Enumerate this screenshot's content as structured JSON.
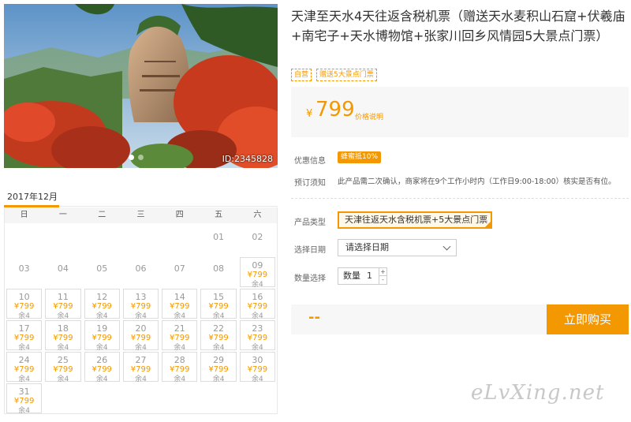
{
  "product": {
    "title": "天津至天水4天往返含税机票（赠送天水麦积山石窟+伏羲庙+南宅子+天水博物馆+张家川回乡风情园5大景点门票）",
    "tags": [
      "自营"
    ],
    "tags2": [
      "赠送5大景点门票"
    ]
  },
  "gallery": {
    "photo_id": "ID:2345828"
  },
  "price": {
    "currency": "¥",
    "value": "799",
    "note": "价格说明"
  },
  "offers": {
    "discount_label": "优惠信息",
    "discount_badge": "蜂蜜抵10%",
    "notice_label": "预订须知",
    "notice_text": "此产品需二次确认，商家将在9个工作小时内（工作日9:00-18:00）核实是否有位。"
  },
  "options": {
    "type_label": "产品类型",
    "type_value": "天津往返天水含税机票+5大景点门票",
    "date_label": "选择日期",
    "date_placeholder": "请选择日期",
    "qty_label": "数量选择",
    "qty_prefix": "数量",
    "qty_value": "1",
    "qty_plus": "+",
    "qty_minus": "-"
  },
  "purchase": {
    "total": "--",
    "buy_label": "立即购买"
  },
  "calendar": {
    "month": "2017年12月",
    "weekdays": [
      "日",
      "一",
      "二",
      "三",
      "四",
      "五",
      "六"
    ],
    "price_text": "¥799",
    "stock_text": "余4",
    "leading_blanks": 5,
    "days": [
      {
        "d": "01",
        "avail": false
      },
      {
        "d": "02",
        "avail": false
      },
      {
        "d": "03",
        "avail": false
      },
      {
        "d": "04",
        "avail": false
      },
      {
        "d": "05",
        "avail": false
      },
      {
        "d": "06",
        "avail": false
      },
      {
        "d": "07",
        "avail": false
      },
      {
        "d": "08",
        "avail": false
      },
      {
        "d": "09",
        "avail": true
      },
      {
        "d": "10",
        "avail": true
      },
      {
        "d": "11",
        "avail": true
      },
      {
        "d": "12",
        "avail": true
      },
      {
        "d": "13",
        "avail": true
      },
      {
        "d": "14",
        "avail": true
      },
      {
        "d": "15",
        "avail": true
      },
      {
        "d": "16",
        "avail": true
      },
      {
        "d": "17",
        "avail": true
      },
      {
        "d": "18",
        "avail": true
      },
      {
        "d": "19",
        "avail": true
      },
      {
        "d": "20",
        "avail": true
      },
      {
        "d": "21",
        "avail": true
      },
      {
        "d": "22",
        "avail": true
      },
      {
        "d": "23",
        "avail": true
      },
      {
        "d": "24",
        "avail": true
      },
      {
        "d": "25",
        "avail": true
      },
      {
        "d": "26",
        "avail": true
      },
      {
        "d": "27",
        "avail": true
      },
      {
        "d": "28",
        "avail": true
      },
      {
        "d": "29",
        "avail": true
      },
      {
        "d": "30",
        "avail": true
      },
      {
        "d": "31",
        "avail": true
      }
    ]
  },
  "watermark": "eLvXing.net",
  "colors": {
    "accent": "#f39800",
    "panel": "#f7f7f7"
  }
}
